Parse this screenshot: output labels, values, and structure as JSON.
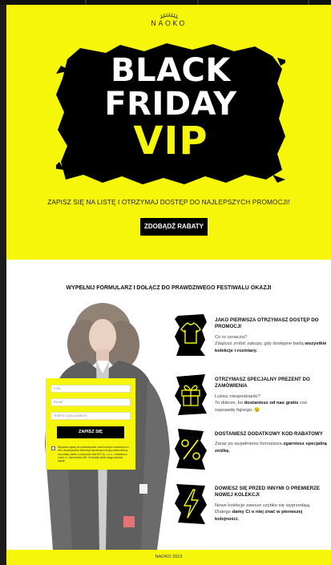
{
  "brand": {
    "logo": "NAOKO"
  },
  "colors": {
    "accent": "#f6f60a",
    "dark": "#000000"
  },
  "hero": {
    "title_line1": "BLACK",
    "title_line2": "FRIDAY",
    "title_line3": "VIP",
    "subheading": "ZAPISZ SIĘ NA LISTĘ I OTRZYMAJ DOSTĘP DO NAJLEPSZYCH PROMOCJI!",
    "cta_label": "ZDOBĄDŹ RABATY"
  },
  "main": {
    "title": "WYPEŁNIJ FORMULARZ I DOŁĄCZ DO PRAWDZIWEGO FESTIWALU OKAZJI"
  },
  "form": {
    "name_placeholder": "Imię",
    "email_placeholder": "Email",
    "phone_placeholder": "Telefon (opcjonalnie)",
    "submit_label": "ZAPISZ SIĘ",
    "consent": "Wyrażam zgodę na przetwarzanie moich danych osobowych w celu otrzymywania informacji handlowych drogą elektroniczną na podany adres e-mail przez NAOKO Sp. z o.o. z siedzibą w Łodzi, ul. Zamenhofa 22B. W każdej chwili mogę odwołać zgodę."
  },
  "benefits": [
    {
      "icon": "tshirt-icon",
      "title": "JAKO PIERWSZA OTRZYMASZ DOSTĘP DO PROMOCJI",
      "text1": "Co to oznacza?",
      "text2": "Zdążysz zrobić zakupy, gdy dostępne będą ",
      "bold": "wszystkie kolekcje i rozmiary."
    },
    {
      "icon": "gift-icon",
      "title": "OTRZYMASZ SPECJALNY PREZENT DO ZAMÓWIENIA",
      "text1": "Lubisz niespodzianki?",
      "text2": "To dobrze, bo ",
      "bold": "dostaniesz od nas gratis",
      "text3": " coś naprawdę fajnego. 😉"
    },
    {
      "icon": "percent-icon",
      "title": "DOSTANIESZ DODATKOWY KOD RABATOWY",
      "text1": "Zaraz po wypełnieniu formularza ",
      "bold": "zgarniesz specjalną zniżkę."
    },
    {
      "icon": "lightning-icon",
      "title": "DOWIESZ SIĘ PRZED INNYMI O PREMIERZE NOWEJ KOLEKCJI",
      "text1": "Nowe kolekcje zawsze szybko się wyprzedają. Dlatego ",
      "bold": "damy Ci o niej znać w pierwszej kolejności."
    }
  ],
  "footer": {
    "text": "NAOKO 2023"
  }
}
